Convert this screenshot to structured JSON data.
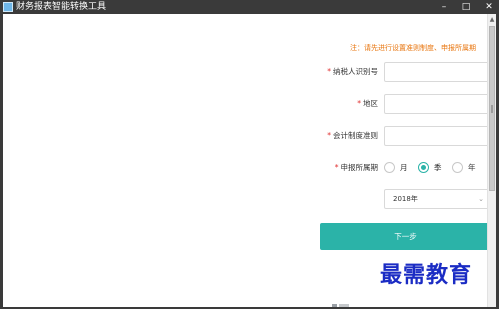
{
  "window": {
    "title": "财务报表智能转换工具",
    "minimize": "–",
    "maximize": "□",
    "close": "✕"
  },
  "form": {
    "notice": "注：请先进行设置准则制度、申报所属期",
    "required_mark": "*",
    "taxpayer_id_label": "纳税人识别号",
    "taxpayer_id_value": "",
    "region_label": "地区",
    "region_value": "",
    "accounting_standard_label": "会计制度准则",
    "accounting_standard_value": "",
    "period_label": "申报所属期",
    "period_options": [
      "月",
      "季",
      "年"
    ],
    "period_selected": "季",
    "year_select": "2018年",
    "next_button": "下一步"
  },
  "watermark": "最需教育",
  "colors": {
    "accent": "#2bb3a8",
    "notice": "#e8740c",
    "required": "#e03030",
    "titlebar": "#3a3a3a",
    "watermark": "#1b2cc4"
  },
  "icons": {
    "app": "spreadsheet-app-icon",
    "select_arrow": "chevron-down-icon",
    "scroll_up": "arrow-up-icon"
  }
}
